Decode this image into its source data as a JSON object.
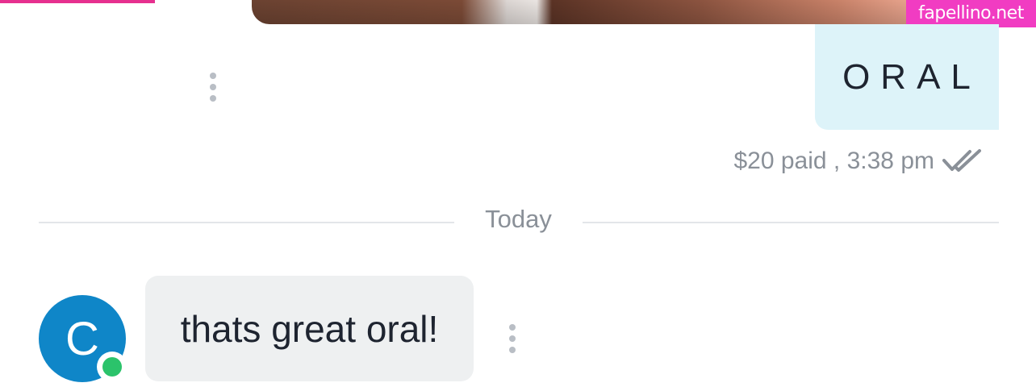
{
  "watermark": {
    "text": "fapellino.net"
  },
  "outgoing_message": {
    "text": "ORAL",
    "meta": "$20 paid , 3:38 pm",
    "status_icon": "double-check-icon",
    "bubble_color": "#ddf3f9"
  },
  "divider": {
    "label": "Today"
  },
  "incoming_message": {
    "avatar_initial": "C",
    "avatar_color": "#0f86c8",
    "online_color": "#2bc36b",
    "text": "thats great oral!",
    "bubble_color": "#eef0f1"
  },
  "accent_color": "#e6308f"
}
